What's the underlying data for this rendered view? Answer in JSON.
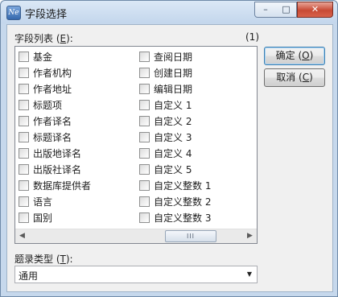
{
  "window": {
    "title": "字段选择",
    "icon_glyph": "Ne",
    "controls": {
      "minimize": "–",
      "maximize": "□",
      "close": "✕"
    }
  },
  "field_list": {
    "label_prefix": "字段列表 (",
    "label_key": "E",
    "label_suffix": "):",
    "count": "(1)",
    "columns": [
      [
        "基金",
        "作者机构",
        "作者地址",
        "标题项",
        "作者译名",
        "标题译名",
        "出版地译名",
        "出版社译名",
        "数据库提供者",
        "语言",
        "国别"
      ],
      [
        "查阅日期",
        "创建日期",
        "编辑日期",
        "自定义 1",
        "自定义 2",
        "自定义 3",
        "自定义 4",
        "自定义 5",
        "自定义整数 1",
        "自定义整数 2",
        "自定义整数 3"
      ]
    ]
  },
  "scrollbar": {
    "left_arrow": "◀",
    "right_arrow": "▶",
    "thumb_grip": "III"
  },
  "buttons": {
    "ok_prefix": "确定 (",
    "ok_key": "O",
    "ok_suffix": ")",
    "cancel_prefix": "取消 (",
    "cancel_key": "C",
    "cancel_suffix": ")"
  },
  "record_type": {
    "label_prefix": "题录类型 (",
    "label_key": "T",
    "label_suffix": "):",
    "value": "通用",
    "arrow": "▼"
  }
}
